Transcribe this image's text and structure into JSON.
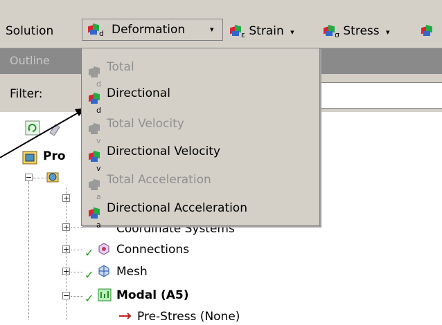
{
  "toolbar": {
    "solution_label": "Solution",
    "deformation_label": "Deformation",
    "strain_label": "Strain",
    "stress_label": "Stress",
    "deformation_sub": "d",
    "strain_sub": "ε",
    "stress_sub": "σ",
    "caret": "▾"
  },
  "outline": {
    "label": "Outline"
  },
  "filter": {
    "label": "Filter:"
  },
  "dropdown": {
    "items": [
      {
        "label": "Total",
        "sub": "d",
        "enabled": false
      },
      {
        "label": "Directional",
        "sub": "d",
        "enabled": true
      },
      {
        "label": "Total Velocity",
        "sub": "v",
        "enabled": false
      },
      {
        "label": "Directional Velocity",
        "sub": "v",
        "enabled": true
      },
      {
        "label": "Total Acceleration",
        "sub": "a",
        "enabled": false
      },
      {
        "label": "Directional Acceleration",
        "sub": "a",
        "enabled": true
      }
    ]
  },
  "tree": {
    "project_label": "Pro",
    "coordinate_systems_label": "Coordinate Systems",
    "connections_label": "Connections",
    "mesh_label": "Mesh",
    "modal_label": "Modal (A5)",
    "prestress_label": "Pre-Stress (None)",
    "expand_plus": "+",
    "expand_minus": "−"
  },
  "colors": {
    "toolbar_bg": "#d4d0c8",
    "outline_bar": "#8a8a8a",
    "disabled_text": "#8f8f8f",
    "check_green": "#1a9a1a"
  }
}
